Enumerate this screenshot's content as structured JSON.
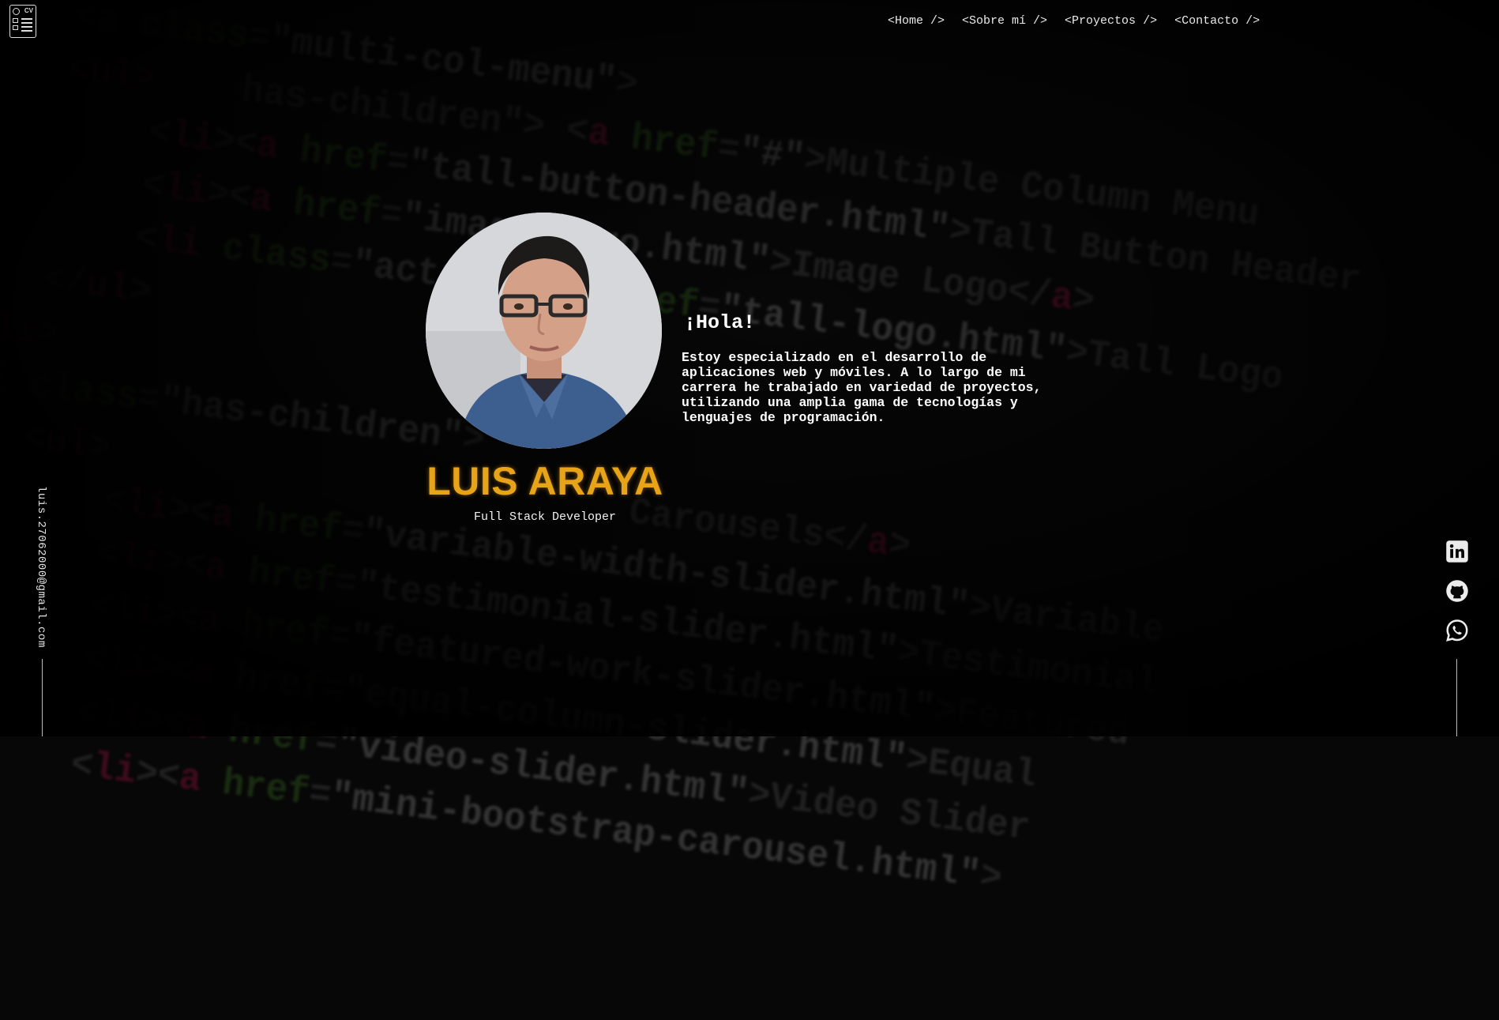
{
  "nav": {
    "home": "<Home />",
    "about": "<Sobre mí />",
    "projects": "<Proyectos />",
    "contact": "<Contacto />"
  },
  "logo": {
    "text": "CV"
  },
  "profile": {
    "name": "LUIS ARAYA",
    "role": "Full Stack Developer",
    "greeting": "¡Hola!",
    "intro": "Estoy especializado en el desarrollo de aplicaciones web y móviles. A lo largo de mi carrera he trabajado en variedad de proyectos, utilizando una amplia gama de tecnologías y lenguajes de programación."
  },
  "email": "luis.27062000@gmail.com",
  "socials": [
    {
      "icon": "linkedin-icon"
    },
    {
      "icon": "github-icon"
    },
    {
      "icon": "whatsapp-icon"
    }
  ],
  "colors": {
    "accent": "#e8a418",
    "background": "#070707",
    "text": "#ffffff"
  }
}
